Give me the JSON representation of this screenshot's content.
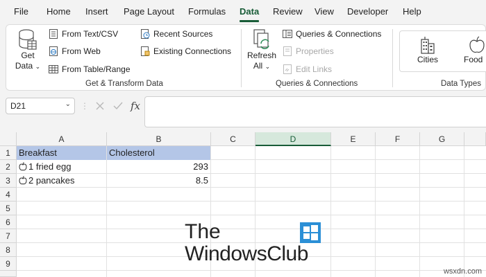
{
  "menu": {
    "tabs": [
      "File",
      "Home",
      "Insert",
      "Page Layout",
      "Formulas",
      "Data",
      "Review",
      "View",
      "Developer",
      "Help"
    ],
    "active": "Data"
  },
  "ribbon": {
    "get_transform": {
      "get_data_line1": "Get",
      "get_data_line2": "Data",
      "from_text_csv": "From Text/CSV",
      "from_web": "From Web",
      "from_table_range": "From Table/Range",
      "recent_sources": "Recent Sources",
      "existing_connections": "Existing Connections",
      "label": "Get & Transform Data"
    },
    "queries": {
      "refresh_line1": "Refresh",
      "refresh_line2": "All",
      "queries_connections": "Queries & Connections",
      "properties": "Properties",
      "edit_links": "Edit Links",
      "label": "Queries & Connections"
    },
    "data_types": {
      "cities": "Cities",
      "food": "Food",
      "label": "Data Types"
    }
  },
  "formula_bar": {
    "name_box": "D21",
    "fx": "fx",
    "formula": ""
  },
  "grid": {
    "columns": [
      "A",
      "B",
      "C",
      "D",
      "E",
      "F",
      "G"
    ],
    "selected_column": "D",
    "rows": [
      "1",
      "2",
      "3",
      "4",
      "5",
      "6",
      "7",
      "8",
      "9"
    ],
    "cells": {
      "A1": "Breakfast",
      "B1": "Cholesterol",
      "A2": "1 fried egg",
      "B2": "293",
      "A3": "2 pancakes",
      "B3": "8.5"
    }
  },
  "watermark": {
    "line1": "The",
    "line2": "WindowsClub",
    "site": "wsxdn.com"
  },
  "colors": {
    "accent": "#185c37",
    "header_fill": "#b4c6e7"
  }
}
